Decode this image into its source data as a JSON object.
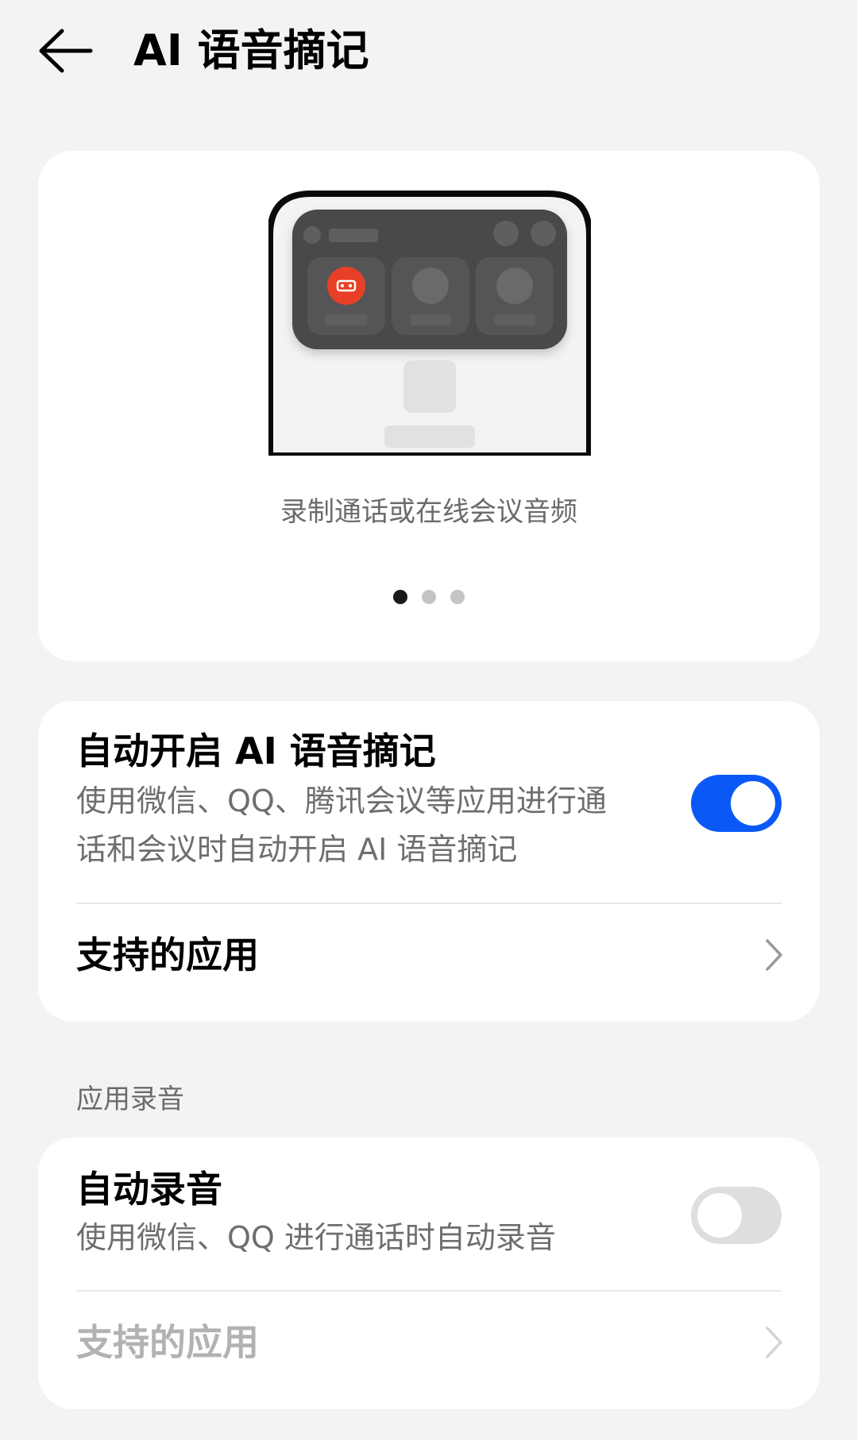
{
  "header": {
    "title": "AI 语音摘记"
  },
  "illustration": {
    "caption": "录制通话或在线会议音频",
    "pages": 3,
    "active_page": 1
  },
  "card1": {
    "toggle_title": "自动开启 AI 语音摘记",
    "toggle_desc": "使用微信、QQ、腾讯会议等应用进行通话和会议时自动开启 AI 语音摘记",
    "toggle_on": true,
    "supported_apps_label": "支持的应用"
  },
  "section": {
    "title": "应用录音"
  },
  "card2": {
    "toggle_title": "自动录音",
    "toggle_desc": "使用微信、QQ 进行通话时自动录音",
    "toggle_on": false,
    "supported_apps_label": "支持的应用",
    "supported_apps_enabled": false
  },
  "colors": {
    "accent": "#0a59f7",
    "background": "#f1f3f5",
    "record_icon": "#e84026"
  }
}
